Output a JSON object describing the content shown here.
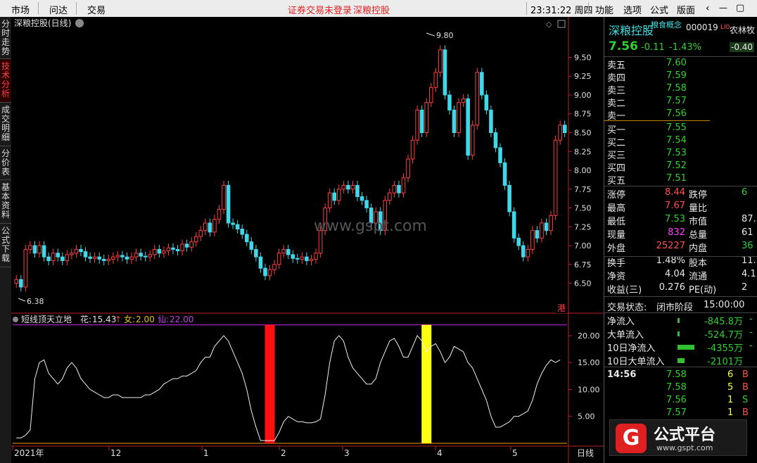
{
  "menubar": {
    "market": "市场",
    "ask": "问达",
    "trade": "交易",
    "notice": "证券交易未登录",
    "stock": "深粮控股",
    "time": "23:31:22 周四",
    "func": "功能",
    "options": "选项",
    "formula": "公式",
    "layout": "版面"
  },
  "sidebar": [
    "分时走势",
    "技术分析",
    "成交明细",
    "分价表",
    "基本资料",
    "公式下载"
  ],
  "chart": {
    "title": "深粮控股(日线)",
    "max_label": "9.80",
    "min_label": "6.38",
    "watermark": "www.gspt.com",
    "hk_badge": "港",
    "price_ticks": [
      "9.50",
      "9.25",
      "9.00",
      "8.75",
      "8.50",
      "8.25",
      "8.00",
      "7.75",
      "7.50",
      "7.25",
      "7.00",
      "6.75",
      "6.50"
    ],
    "indicator_name": "短线顶天立地",
    "ind_hua_label": "花:",
    "ind_hua_val": "15.43",
    "ind_nv_label": "女:",
    "ind_nv_val": "2.00",
    "ind_xian_label": "仙:",
    "ind_xian_val": "22.00",
    "ind_ticks": [
      "20.00",
      "15.00",
      "10.00",
      "5.00"
    ],
    "x_labels": [
      "2021年",
      "12",
      "1",
      "2",
      "3",
      "4",
      "5"
    ],
    "period": "日线"
  },
  "quote": {
    "name": "深粮控股",
    "concept": "粮食概念",
    "code": "000019",
    "peer": "农林牧",
    "li": "LI0",
    "price": "7.56",
    "change": "-0.11",
    "pct": "-1.43%",
    "peer_pct": "-0.40",
    "asks": [
      [
        "卖五",
        "7.60"
      ],
      [
        "卖四",
        "7.59"
      ],
      [
        "卖三",
        "7.58"
      ],
      [
        "卖二",
        "7.57"
      ],
      [
        "卖一",
        "7.56"
      ]
    ],
    "bids": [
      [
        "买一",
        "7.55"
      ],
      [
        "买二",
        "7.54"
      ],
      [
        "买三",
        "7.53"
      ],
      [
        "买四",
        "7.52"
      ],
      [
        "买五",
        "7.51"
      ]
    ],
    "stats": [
      [
        "涨停",
        "8.44",
        "跌停",
        "6"
      ],
      [
        "最高",
        "7.67",
        "量比",
        ""
      ],
      [
        "最低",
        "7.53",
        "市值",
        "87."
      ],
      [
        "现量",
        "832",
        "总量",
        "61"
      ],
      [
        "外盘",
        "25227",
        "内盘",
        "36"
      ],
      [
        "换手",
        "1.48%",
        "股本",
        "11."
      ],
      [
        "净资",
        "4.04",
        "流通",
        "4.1"
      ],
      [
        "收益(三)",
        "0.276",
        "PE(动)",
        "2"
      ]
    ],
    "trade_status_label": "交易状态:",
    "trade_status": "闭市阶段",
    "trade_time": "15:00:00",
    "flows": [
      [
        "净流入",
        "-845.8万",
        "-"
      ],
      [
        "大单流入",
        "-524.7万",
        "-"
      ],
      [
        "10日净流入",
        "-4355万",
        "-"
      ],
      [
        "10日大单流入",
        "-2101万",
        ""
      ]
    ],
    "ticks": [
      [
        "14:56",
        "7.58",
        "6",
        "B"
      ],
      [
        "",
        "7.58",
        "5",
        "B"
      ],
      [
        "",
        "7.56",
        "1",
        "S"
      ],
      [
        "",
        "7.57",
        "1",
        "B"
      ]
    ]
  },
  "logo": {
    "text": "公式平台",
    "url": "www.gspt.com"
  },
  "chart_data": {
    "type": "candlestick",
    "ylim": [
      6.3,
      9.85
    ],
    "ind_ylim": [
      0,
      23
    ],
    "n": 120,
    "price_closes": [
      6.55,
      6.45,
      6.95,
      7.0,
      6.9,
      7.0,
      6.85,
      6.8,
      6.9,
      6.85,
      6.8,
      6.88,
      6.9,
      6.95,
      6.92,
      6.85,
      6.83,
      6.85,
      6.82,
      6.8,
      6.82,
      6.85,
      6.87,
      6.85,
      6.82,
      6.85,
      6.9,
      6.86,
      6.85,
      6.88,
      6.95,
      6.9,
      6.93,
      6.97,
      6.95,
      6.93,
      7.02,
      6.98,
      7.05,
      7.12,
      7.2,
      7.3,
      7.18,
      7.35,
      7.48,
      7.8,
      7.3,
      7.28,
      7.22,
      7.15,
      7.05,
      6.95,
      6.85,
      6.7,
      6.6,
      6.68,
      6.75,
      6.9,
      6.95,
      6.88,
      6.83,
      6.82,
      6.85,
      6.8,
      6.82,
      6.9,
      7.2,
      7.5,
      7.7,
      7.6,
      7.75,
      7.8,
      7.75,
      7.8,
      7.65,
      7.6,
      7.5,
      7.3,
      7.45,
      7.2,
      7.6,
      7.7,
      7.8,
      7.7,
      7.9,
      8.15,
      8.4,
      8.8,
      8.5,
      8.9,
      9.1,
      9.3,
      9.6,
      9.0,
      8.8,
      8.5,
      8.9,
      8.95,
      8.2,
      8.6,
      9.3,
      9.0,
      8.8,
      8.5,
      8.3,
      8.1,
      7.8,
      7.45,
      7.1,
      7.0,
      6.85,
      6.95,
      7.2,
      7.1,
      7.3,
      7.2,
      7.4,
      8.4,
      8.6,
      8.5
    ],
    "ind_values": [
      1,
      1,
      1.5,
      2.5,
      12,
      15,
      15.5,
      13,
      12,
      11,
      12,
      14,
      15,
      14,
      12,
      11,
      10,
      9.5,
      9,
      8.5,
      8.5,
      9,
      9,
      8.5,
      8.5,
      8.5,
      8.5,
      8.5,
      9,
      9,
      9.5,
      10,
      11,
      11.5,
      12,
      12,
      12.5,
      12.5,
      13,
      13.5,
      15,
      16,
      16,
      18,
      19,
      20,
      19,
      17,
      15,
      13,
      10,
      6,
      3,
      0.5,
      0.5,
      0.5,
      0.5,
      2,
      4,
      5,
      4.5,
      4,
      4,
      3.8,
      3.8,
      4,
      4.5,
      9,
      15,
      19,
      20,
      19,
      16,
      14,
      13,
      12,
      11,
      11,
      12,
      15,
      17,
      19,
      19.5,
      18,
      16,
      16,
      18,
      20,
      19,
      17,
      18,
      18.5,
      17,
      15,
      16,
      18,
      17.5,
      17,
      15,
      14,
      12,
      10,
      8,
      5,
      3,
      3,
      3.5,
      4,
      5,
      5,
      5.5,
      6,
      8,
      11,
      13,
      14.5,
      15.5,
      15,
      15.5
    ],
    "signal_bars": [
      {
        "index": 55,
        "color": "red",
        "value": 22
      },
      {
        "index": 89,
        "color": "yellow",
        "value": 22
      }
    ],
    "ref_lines": [
      {
        "name": "仙",
        "value": 22,
        "color": "#a020c0"
      },
      {
        "name": "女",
        "value": 0,
        "color": "#c08000"
      }
    ]
  }
}
